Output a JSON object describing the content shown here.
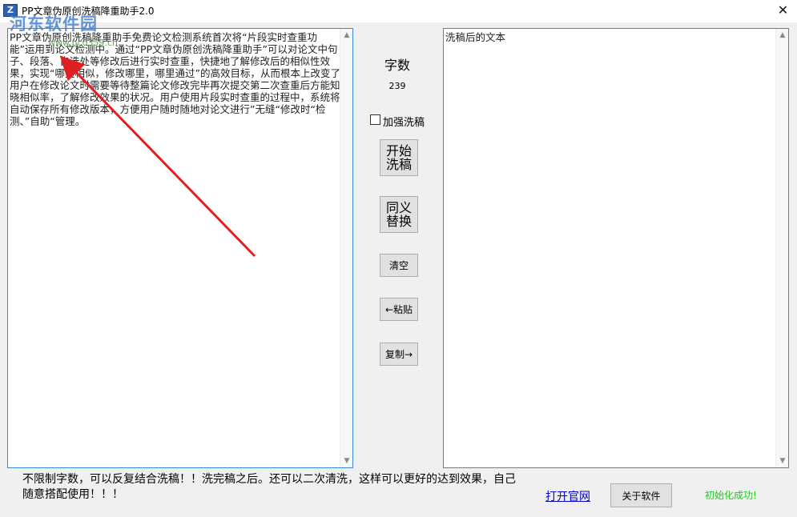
{
  "window": {
    "title": "PP文章伪原创洗稿降重助手2.0",
    "icon_name": "app-logo-icon",
    "close_glyph": "✕"
  },
  "watermark": {
    "text": "河东软件园",
    "site": "www.pc0359.cn"
  },
  "input_pane": {
    "text": "PP文章伪原创洗稿降重助手免费论文检测系统首次将“片段实时查重功能”运用到论文检测中。通过“PP文章伪原创洗稿降重助手”可以对论文中句子、段落、自选处等修改后进行实时查重，快捷地了解修改后的相似性效果，实现“哪里相似，修改哪里，哪里通过”的高效目标，从而根本上改变了用户在修改论文时需要等待整篇论文修改完毕再次提交第二次查重后方能知晓相似率，了解修改效果的状况。用户使用片段实时查重的过程中，系统将自动保存所有修改版本，方便用户随时随地对论文进行”无缝“修改时“检测、”自助“管理。"
  },
  "output_pane": {
    "text": "洗稿后的文本"
  },
  "controls": {
    "count_label": "字数",
    "count_value": "239",
    "enhance_label": "加强洗稿",
    "enhance_checked": false,
    "start_label": "开始\n洗稿",
    "synonym_label": "同义\n替换",
    "clear_label": "清空",
    "paste_label": "←粘贴",
    "copy_label": "复制→"
  },
  "footer": {
    "note": "不限制字数，可以反复结合洗稿！！洗完稿之后。还可以二次清洗，这样可以更好的达到效果，自己随意搭配使用！！！",
    "link_label": "打开官网",
    "about_label": "关于软件",
    "status": "初始化成功!"
  },
  "colors": {
    "status_green": "#1ec81e",
    "link_blue": "#0000cc",
    "annotation_arrow": "#e02020",
    "focus_border": "#3d86d8"
  }
}
